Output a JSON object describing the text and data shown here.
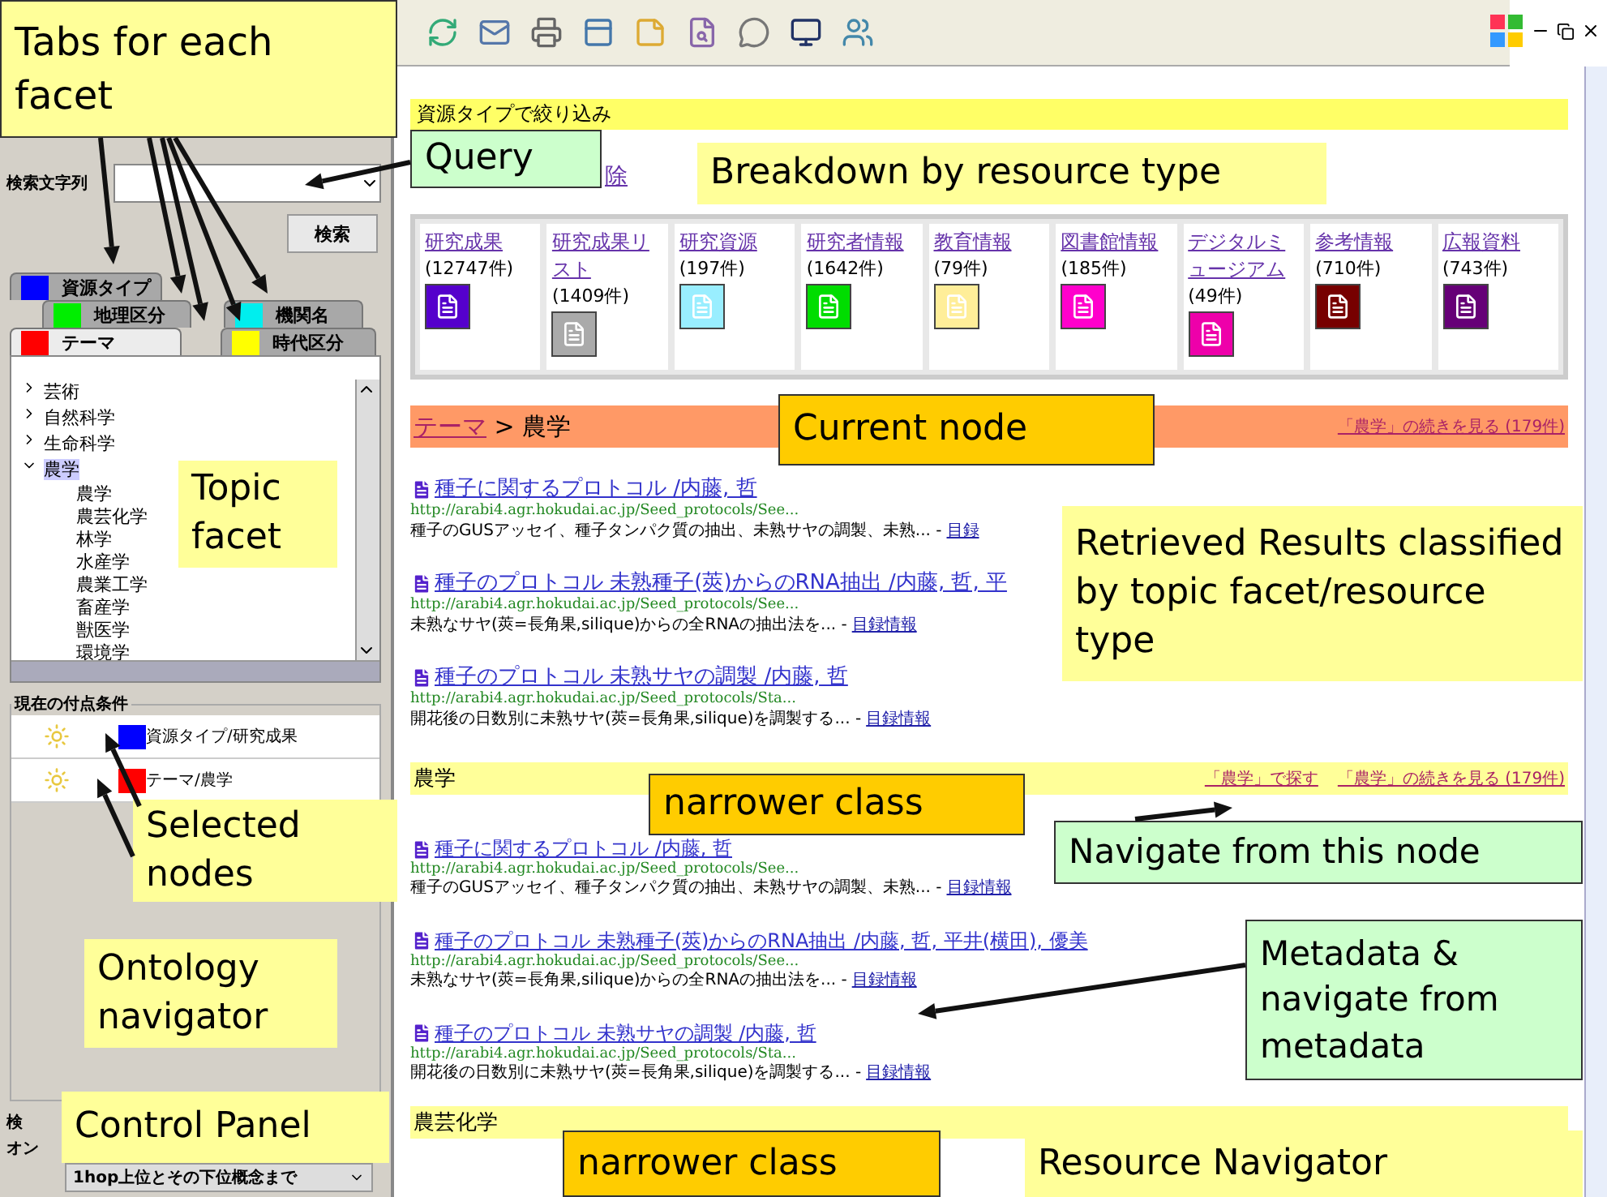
{
  "left_panel": {
    "query_label": "検索文字列",
    "search_button": "検索",
    "tab_rows": [
      [
        {
          "label": "資源タイプ",
          "color": "#0000ff",
          "selected": false
        }
      ],
      [
        {
          "label": "地理区分",
          "color": "#00ee00",
          "selected": false
        },
        {
          "label": "機関名",
          "color": "#00eeee",
          "selected": false
        }
      ],
      [
        {
          "label": "テーマ",
          "color": "#ff0000",
          "selected": true
        },
        {
          "label": "時代区分",
          "color": "#ffff00",
          "selected": false
        }
      ]
    ],
    "tree": [
      {
        "label": "芸術",
        "expanded": false,
        "selected": false
      },
      {
        "label": "自然科学",
        "expanded": false,
        "selected": false
      },
      {
        "label": "生命科学",
        "expanded": false,
        "selected": false
      },
      {
        "label": "農学",
        "expanded": true,
        "selected": true,
        "children": [
          {
            "label": "農学"
          },
          {
            "label": "農芸化学"
          },
          {
            "label": "林学"
          },
          {
            "label": "水産学"
          },
          {
            "label": "農業工学"
          },
          {
            "label": "畜産学"
          },
          {
            "label": "獣医学"
          },
          {
            "label": "環境学"
          }
        ]
      }
    ],
    "conditions_title": "現在の付点条件",
    "conditions": [
      {
        "label": "資源タイプ/研究成果",
        "color": "#0000ff"
      },
      {
        "label": "テーマ/農学",
        "color": "#ff0000"
      }
    ],
    "control_labels": [
      "検",
      "オン"
    ],
    "hop_select": "1hop上位とその下位概念まで"
  },
  "content": {
    "filter_title": "資源タイプで絞り込み",
    "clear_link": "除",
    "resource_types": [
      {
        "label": "研究成果",
        "count": "(12747件)",
        "color": "#5500cc"
      },
      {
        "label": "研究成果リスト",
        "count": "(1409件)",
        "color": "#aaaaaa"
      },
      {
        "label": "研究資源",
        "count": "(197件)",
        "color": "#99eeff"
      },
      {
        "label": "研究者情報",
        "count": "(1642件)",
        "color": "#00dd00"
      },
      {
        "label": "教育情報",
        "count": "(79件)",
        "color": "#ffee99"
      },
      {
        "label": "図書館情報",
        "count": "(185件)",
        "color": "#ff00cc"
      },
      {
        "label": "デジタルミュージアム",
        "count": "(49件)",
        "color": "#ee00aa"
      },
      {
        "label": "参考情報",
        "count": "(710件)",
        "color": "#770000"
      },
      {
        "label": "広報資料",
        "count": "(743件)",
        "color": "#660077"
      }
    ],
    "current": {
      "crumb_link": "テーマ",
      "crumb_sep": ">",
      "crumb_node": "農学",
      "more_link": "「農学」の続きを見る (179件)"
    },
    "results": [
      {
        "title": "種子に関するプロトコル /内藤, 哲",
        "url": "http://arabi4.agr.hokudai.ac.jp/Seed_protocols/See...",
        "snippet": "種子のGUSアッセイ、種子タンパク質の抽出、未熟サヤの調製、未熟... -",
        "link": "目録"
      },
      {
        "title": "種子のプロトコル 未熟種子(莢)からのRNA抽出 /内藤, 哲, 平",
        "url": "http://arabi4.agr.hokudai.ac.jp/Seed_protocols/See...",
        "snippet": "未熟なサヤ(莢=長角果,silique)からの全RNAの抽出法を... -",
        "link": "目録情報"
      },
      {
        "title": "種子のプロトコル 未熟サヤの調製 /内藤, 哲",
        "url": "http://arabi4.agr.hokudai.ac.jp/Seed_protocols/Sta...",
        "snippet": "開花後の日数別に未熟サヤ(莢=長角果,silique)を調製する... -",
        "link": "目録情報"
      }
    ],
    "sections": [
      {
        "title": "農学",
        "links": [
          "「農学」で探す",
          "「農学」の続きを見る (179件)"
        ],
        "results": [
          {
            "title": "種子に関するプロトコル /内藤, 哲",
            "url": "http://arabi4.agr.hokudai.ac.jp/Seed_protocols/See...",
            "snippet": "種子のGUSアッセイ、種子タンパク質の抽出、未熟サヤの調製、未熟... -",
            "link": "目録情報"
          },
          {
            "title": "種子のプロトコル 未熟種子(莢)からのRNA抽出 /内藤, 哲, 平井(横田), 優美",
            "url": "http://arabi4.agr.hokudai.ac.jp/Seed_protocols/See...",
            "snippet": "未熟なサヤ(莢=長角果,silique)からの全RNAの抽出法を... -",
            "link": "目録情報"
          },
          {
            "title": "種子のプロトコル 未熟サヤの調製 /内藤, 哲",
            "url": "http://arabi4.agr.hokudai.ac.jp/Seed_protocols/Sta...",
            "snippet": "開花後の日数別に未熟サヤ(莢=長角果,silique)を調製する... -",
            "link": "目録情報"
          }
        ]
      },
      {
        "title": "農芸化学"
      }
    ]
  },
  "callouts": [
    {
      "text": "Tabs for each facet",
      "kind": "note"
    },
    {
      "text": "Query",
      "kind": "green"
    },
    {
      "text": "Breakdown by resource type",
      "kind": "plain"
    },
    {
      "text": "Topic facet",
      "kind": "plain"
    },
    {
      "text": "Current node",
      "kind": "orange"
    },
    {
      "text": "Retrieved Results classified by topic facet/resource type",
      "kind": "plain"
    },
    {
      "text": "Selected nodes",
      "kind": "plain"
    },
    {
      "text": "narrower class",
      "kind": "orange"
    },
    {
      "text": "Navigate from this node",
      "kind": "green"
    },
    {
      "text": "Ontology navigator",
      "kind": "plain"
    },
    {
      "text": "Metadata & navigate from metadata",
      "kind": "green"
    },
    {
      "text": "Control Panel",
      "kind": "plain"
    },
    {
      "text": "narrower class",
      "kind": "orange"
    },
    {
      "text": "Resource Navigator",
      "kind": "plain"
    }
  ]
}
